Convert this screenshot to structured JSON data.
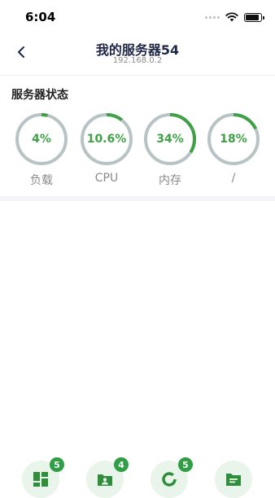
{
  "status_bar": {
    "time": "6:04"
  },
  "header": {
    "title": "我的服务器54",
    "subtitle": "192.168.0.2"
  },
  "server_status": {
    "title": "服务器状态",
    "gauges": [
      {
        "value_text": "4%",
        "label": "负载",
        "percent": 4
      },
      {
        "value_text": "10.6%",
        "label": "CPU",
        "percent": 10.6
      },
      {
        "value_text": "34%",
        "label": "内存",
        "percent": 34
      },
      {
        "value_text": "18%",
        "label": "/",
        "percent": 18
      }
    ],
    "colors": {
      "track": "#b8c3c6",
      "progress": "#3fa145",
      "value_text": "#3fa145"
    }
  },
  "bottom_tabs": [
    {
      "icon": "dashboard-icon",
      "badge": "5"
    },
    {
      "icon": "user-folder-icon",
      "badge": "4"
    },
    {
      "icon": "ring-chart-icon",
      "badge": "5"
    },
    {
      "icon": "document-icon",
      "badge": ""
    }
  ]
}
